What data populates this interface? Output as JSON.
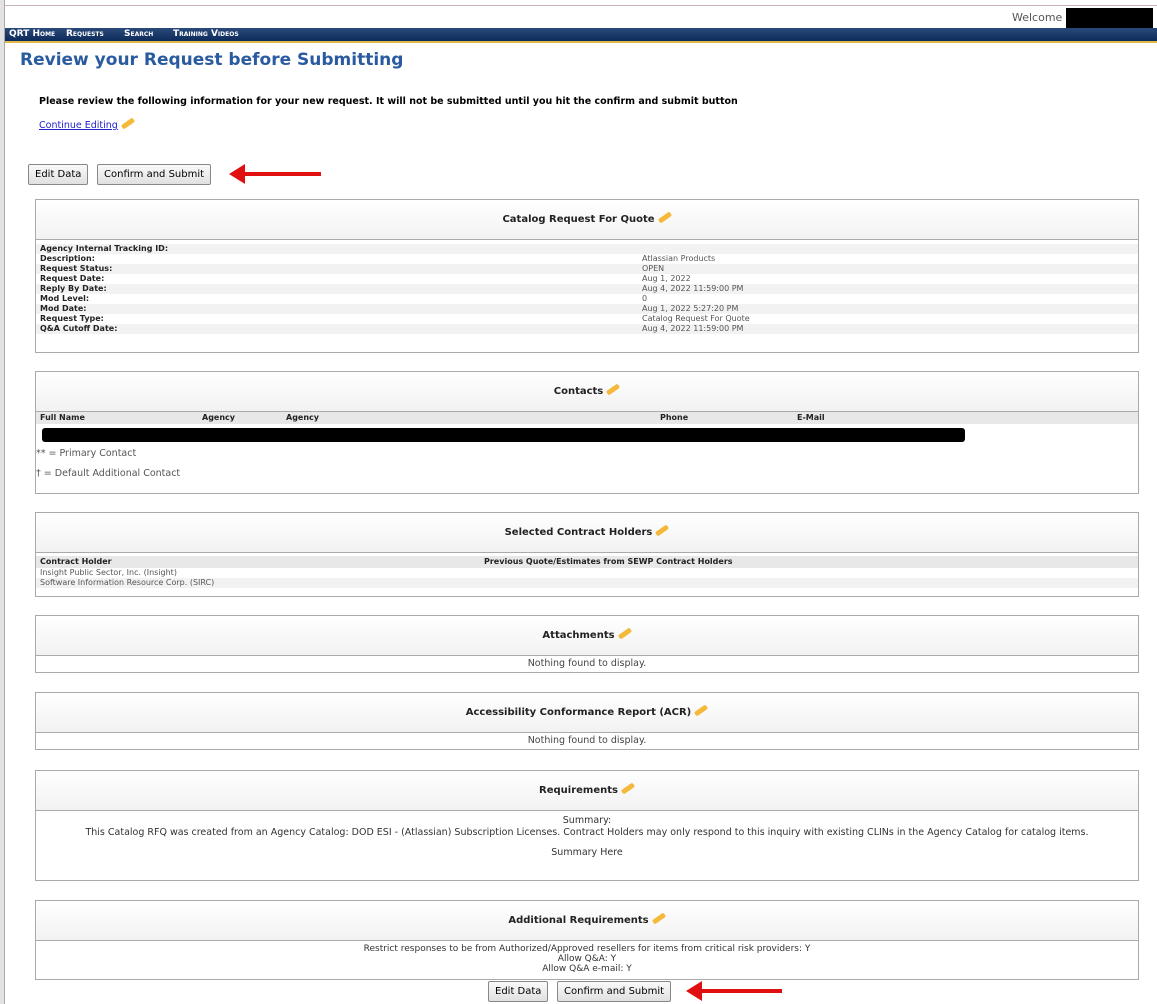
{
  "header": {
    "welcome": "Welcome",
    "nav": [
      "QRT Home",
      "Requests",
      "Search",
      "Training Videos"
    ]
  },
  "page": {
    "title": "Review your Request before Submitting",
    "intro": "Please review the following information for your new request. It will not be submitted until you hit the confirm and submit button",
    "continue_link": "Continue Editing"
  },
  "buttons": {
    "edit": "Edit Data",
    "confirm": "Confirm and Submit"
  },
  "catalog": {
    "title": "Catalog Request For Quote",
    "rows": [
      {
        "label": "Agency Internal Tracking ID:",
        "value": ""
      },
      {
        "label": "Description:",
        "value": "Atlassian Products"
      },
      {
        "label": "Request Status:",
        "value": "OPEN"
      },
      {
        "label": "Request Date:",
        "value": "Aug 1, 2022"
      },
      {
        "label": "Reply By Date:",
        "value": "Aug 4, 2022 11:59:00 PM"
      },
      {
        "label": "Mod Level:",
        "value": "0"
      },
      {
        "label": "Mod Date:",
        "value": "Aug 1, 2022 5:27:20 PM"
      },
      {
        "label": "Request Type:",
        "value": "Catalog Request For Quote"
      },
      {
        "label": "Q&A Cutoff Date:",
        "value": "Aug 4, 2022 11:59:00 PM"
      }
    ]
  },
  "contacts": {
    "title": "Contacts",
    "columns": [
      "Full Name",
      "Agency",
      "Agency",
      "Phone",
      "E-Mail"
    ],
    "legend_primary": "** = Primary Contact",
    "legend_default": "† = Default Additional Contact"
  },
  "holders": {
    "title": "Selected Contract Holders",
    "columns": [
      "Contract Holder",
      "Previous Quote/Estimates from SEWP Contract Holders"
    ],
    "rows": [
      "Insight Public Sector, Inc. (Insight)",
      "Software Information Resource Corp. (SIRC)"
    ]
  },
  "attachments": {
    "title": "Attachments",
    "empty": "Nothing found to display."
  },
  "acr": {
    "title": "Accessibility Conformance Report (ACR)",
    "empty": "Nothing found to display."
  },
  "requirements": {
    "title": "Requirements",
    "summary_label": "Summary:",
    "text": "This Catalog RFQ was created from an Agency Catalog: DOD ESI - (Atlassian) Subscription Licenses. Contract Holders may only respond to this inquiry with existing CLINs in the Agency Catalog for catalog items.",
    "summary_here": "Summary Here"
  },
  "additional": {
    "title": "Additional Requirements",
    "lines": [
      "Restrict responses to be from Authorized/Approved resellers for items from critical risk providers: Y",
      "Allow Q&A: Y",
      "Allow Q&A e-mail: Y"
    ]
  }
}
